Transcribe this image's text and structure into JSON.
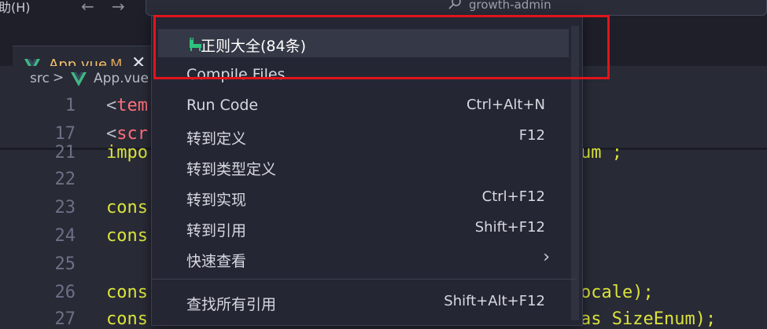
{
  "window": {
    "menu_help": "助(H)",
    "back_arrow": "←",
    "forward_arrow": "→",
    "command_center_text": "growth-admin"
  },
  "tab": {
    "label": "App.vue",
    "modified": "M",
    "close": "✕"
  },
  "breadcrumb": {
    "folder": "src",
    "separator": ">",
    "file": "App.vue"
  },
  "editor": {
    "lines": [
      {
        "num": "1",
        "code_a": "<",
        "code_b": "tem"
      },
      {
        "num": "17",
        "code_a": "<",
        "code_b": "scr"
      },
      {
        "num": "21",
        "code_a": "impo",
        "code_b": ""
      },
      {
        "num": "22",
        "code_a": "",
        "code_b": ""
      },
      {
        "num": "23",
        "code_a": "cons",
        "code_b": ""
      },
      {
        "num": "24",
        "code_a": "cons",
        "code_b": ""
      },
      {
        "num": "25",
        "code_a": "",
        "code_b": ""
      },
      {
        "num": "26",
        "code_a": "cons",
        "code_b": ""
      },
      {
        "num": "27",
        "code_a": "cons",
        "code_b": ""
      }
    ],
    "right_fragments": {
      "line21": "um ;",
      "line26": "ocale);",
      "line27": "as SizeEnum);"
    }
  },
  "context_menu": {
    "items": [
      {
        "label": "正则大全(84条)",
        "shortcut": ""
      },
      {
        "label": "Compile Files",
        "shortcut": ""
      },
      {
        "label": "Run Code",
        "shortcut": "Ctrl+Alt+N"
      },
      {
        "label": "转到定义",
        "shortcut": "F12"
      },
      {
        "label": "转到类型定义",
        "shortcut": ""
      },
      {
        "label": "转到实现",
        "shortcut": "Ctrl+F12"
      },
      {
        "label": "转到引用",
        "shortcut": "Shift+F12"
      },
      {
        "label": "快速查看",
        "shortcut": ""
      },
      {
        "label": "查找所有引用",
        "shortcut": "Shift+Alt+F12"
      }
    ],
    "submenu_chevron": "›"
  },
  "colors": {
    "highlight_box": "#e0151c",
    "vue_green": "#41b883",
    "tab_label": "#f5c26b"
  },
  "icons": {
    "vue_tab": "vue-logo-icon",
    "vue_breadcrumb": "vue-logo-icon",
    "regex_extension": "cat-icon",
    "search": "search-icon"
  }
}
